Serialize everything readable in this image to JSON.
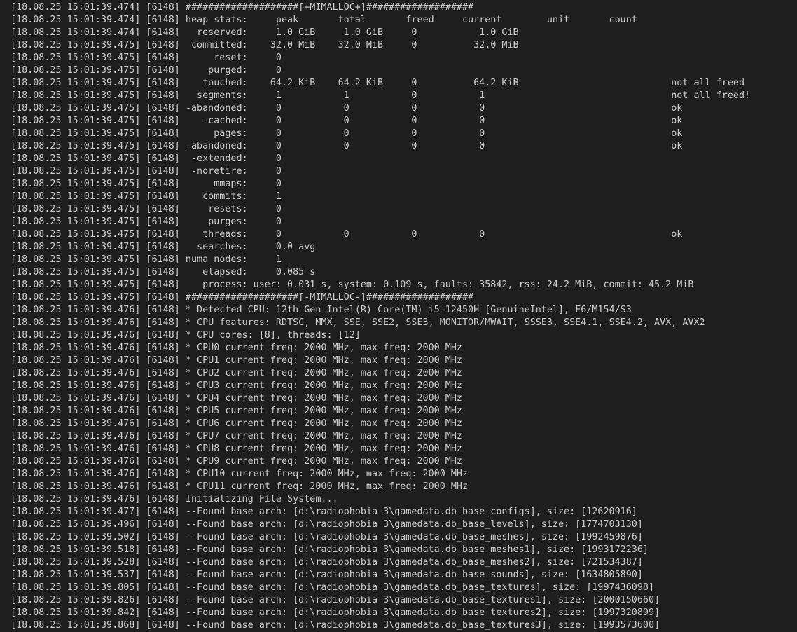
{
  "console": {
    "text_color": "#cccccc",
    "background": "#1e1e1e",
    "lines": [
      "[18.08.25 15:01:39.474] [6148] ####################[+MIMALLOC+]###################",
      "[18.08.25 15:01:39.474] [6148] heap stats:     peak       total       freed     current        unit       count",
      "[18.08.25 15:01:39.474] [6148]   reserved:     1.0 GiB     1.0 GiB     0           1.0 GiB",
      "[18.08.25 15:01:39.475] [6148]  committed:    32.0 MiB    32.0 MiB     0          32.0 MiB",
      "[18.08.25 15:01:39.475] [6148]      reset:     0",
      "[18.08.25 15:01:39.475] [6148]     purged:     0",
      "[18.08.25 15:01:39.475] [6148]    touched:    64.2 KiB    64.2 KiB     0          64.2 KiB                           not all freed",
      "[18.08.25 15:01:39.475] [6148]   segments:     1           1           0           1                                 not all freed!",
      "[18.08.25 15:01:39.475] [6148] -abandoned:     0           0           0           0                                 ok",
      "[18.08.25 15:01:39.475] [6148]    -cached:     0           0           0           0                                 ok",
      "[18.08.25 15:01:39.475] [6148]      pages:     0           0           0           0                                 ok",
      "[18.08.25 15:01:39.475] [6148] -abandoned:     0           0           0           0                                 ok",
      "[18.08.25 15:01:39.475] [6148]  -extended:     0",
      "[18.08.25 15:01:39.475] [6148]  -noretire:     0",
      "[18.08.25 15:01:39.475] [6148]      mmaps:     0",
      "[18.08.25 15:01:39.475] [6148]    commits:     1",
      "[18.08.25 15:01:39.475] [6148]     resets:     0",
      "[18.08.25 15:01:39.475] [6148]     purges:     0",
      "[18.08.25 15:01:39.475] [6148]    threads:     0           0           0           0                                 ok",
      "[18.08.25 15:01:39.475] [6148]   searches:     0.0 avg",
      "[18.08.25 15:01:39.475] [6148] numa nodes:     1",
      "[18.08.25 15:01:39.475] [6148]    elapsed:     0.085 s",
      "[18.08.25 15:01:39.475] [6148]    process: user: 0.031 s, system: 0.109 s, faults: 35842, rss: 24.2 MiB, commit: 45.2 MiB",
      "[18.08.25 15:01:39.475] [6148] ####################[-MIMALLOC-]###################",
      "[18.08.25 15:01:39.476] [6148] * Detected CPU: 12th Gen Intel(R) Core(TM) i5-12450H [GenuineIntel], F6/M154/S3",
      "[18.08.25 15:01:39.476] [6148] * CPU features: RDTSC, MMX, SSE, SSE2, SSE3, MONITOR/MWAIT, SSSE3, SSE4.1, SSE4.2, AVX, AVX2",
      "[18.08.25 15:01:39.476] [6148] * CPU cores: [8], threads: [12]",
      "[18.08.25 15:01:39.476] [6148] * CPU0 current freq: 2000 MHz, max freq: 2000 MHz",
      "[18.08.25 15:01:39.476] [6148] * CPU1 current freq: 2000 MHz, max freq: 2000 MHz",
      "[18.08.25 15:01:39.476] [6148] * CPU2 current freq: 2000 MHz, max freq: 2000 MHz",
      "[18.08.25 15:01:39.476] [6148] * CPU3 current freq: 2000 MHz, max freq: 2000 MHz",
      "[18.08.25 15:01:39.476] [6148] * CPU4 current freq: 2000 MHz, max freq: 2000 MHz",
      "[18.08.25 15:01:39.476] [6148] * CPU5 current freq: 2000 MHz, max freq: 2000 MHz",
      "[18.08.25 15:01:39.476] [6148] * CPU6 current freq: 2000 MHz, max freq: 2000 MHz",
      "[18.08.25 15:01:39.476] [6148] * CPU7 current freq: 2000 MHz, max freq: 2000 MHz",
      "[18.08.25 15:01:39.476] [6148] * CPU8 current freq: 2000 MHz, max freq: 2000 MHz",
      "[18.08.25 15:01:39.476] [6148] * CPU9 current freq: 2000 MHz, max freq: 2000 MHz",
      "[18.08.25 15:01:39.476] [6148] * CPU10 current freq: 2000 MHz, max freq: 2000 MHz",
      "[18.08.25 15:01:39.476] [6148] * CPU11 current freq: 2000 MHz, max freq: 2000 MHz",
      "[18.08.25 15:01:39.476] [6148] Initializing File System...",
      "[18.08.25 15:01:39.477] [6148] --Found base arch: [d:\\radiophobia 3\\gamedata.db_base_configs], size: [12620916]",
      "[18.08.25 15:01:39.496] [6148] --Found base arch: [d:\\radiophobia 3\\gamedata.db_base_levels], size: [1774703130]",
      "[18.08.25 15:01:39.502] [6148] --Found base arch: [d:\\radiophobia 3\\gamedata.db_base_meshes], size: [1992459876]",
      "[18.08.25 15:01:39.518] [6148] --Found base arch: [d:\\radiophobia 3\\gamedata.db_base_meshes1], size: [1993172236]",
      "[18.08.25 15:01:39.528] [6148] --Found base arch: [d:\\radiophobia 3\\gamedata.db_base_meshes2], size: [721534387]",
      "[18.08.25 15:01:39.537] [6148] --Found base arch: [d:\\radiophobia 3\\gamedata.db_base_sounds], size: [1634805890]",
      "[18.08.25 15:01:39.805] [6148] --Found base arch: [d:\\radiophobia 3\\gamedata.db_base_textures], size: [1997436098]",
      "[18.08.25 15:01:39.826] [6148] --Found base arch: [d:\\radiophobia 3\\gamedata.db_base_textures1], size: [2000150660]",
      "[18.08.25 15:01:39.842] [6148] --Found base arch: [d:\\radiophobia 3\\gamedata.db_base_textures2], size: [1997320899]",
      "[18.08.25 15:01:39.868] [6148] --Found base arch: [d:\\radiophobia 3\\gamedata.db_base_textures3], size: [1993573600]"
    ]
  }
}
